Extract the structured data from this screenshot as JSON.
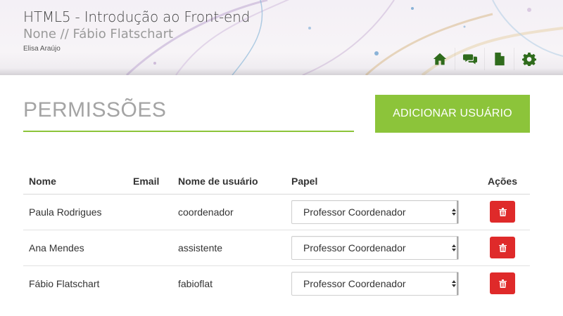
{
  "header": {
    "course_title": "HTML5 - Introdução ao Front-end",
    "course_subtitle": "None // Fábio Flatschart",
    "user_name": "Elisa Araújo",
    "toolbar": [
      {
        "icon": "home-icon"
      },
      {
        "icon": "chat-icon"
      },
      {
        "icon": "document-icon"
      },
      {
        "icon": "gear-icon"
      }
    ]
  },
  "page": {
    "title": "PERMISSÕES",
    "add_button_label": "ADICIONAR USUÁRIO"
  },
  "table": {
    "headers": {
      "nome": "Nome",
      "email": "Email",
      "username": "Nome de usuário",
      "papel": "Papel",
      "acoes": "Ações"
    },
    "rows": [
      {
        "nome": "Paula Rodrigues",
        "email": "",
        "username": "coordenador",
        "papel": "Professor Coordenador"
      },
      {
        "nome": "Ana Mendes",
        "email": "",
        "username": "assistente",
        "papel": "Professor Coordenador"
      },
      {
        "nome": "Fábio Flatschart",
        "email": "",
        "username": "fabioflat",
        "papel": "Professor Coordenador"
      }
    ]
  },
  "colors": {
    "accent": "#8cc43a",
    "danger": "#df2a2a",
    "icon": "#2f6b1c"
  }
}
